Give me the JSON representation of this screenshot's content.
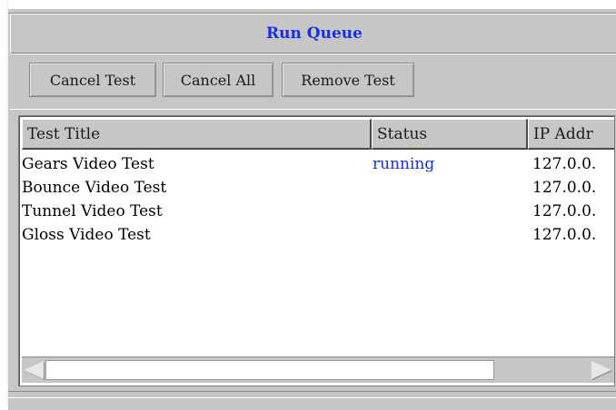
{
  "window": {
    "title": "Run Queue"
  },
  "toolbar": {
    "cancel_test": "Cancel Test",
    "cancel_all": "Cancel All",
    "remove_test": "Remove Test"
  },
  "table": {
    "columns": [
      "Test Title",
      "Status",
      "IP Addr"
    ],
    "rows": [
      {
        "title": "Gears Video Test",
        "status": "running",
        "ip": "127.0.0."
      },
      {
        "title": "Bounce Video Test",
        "status": "",
        "ip": "127.0.0."
      },
      {
        "title": "Tunnel Video Test",
        "status": "",
        "ip": "127.0.0."
      },
      {
        "title": "Gloss Video Test",
        "status": "",
        "ip": "127.0.0."
      }
    ]
  },
  "colors": {
    "title": "#1a2ee0",
    "status_running": "#1a2ee0",
    "panel": "#c6c6c6"
  }
}
